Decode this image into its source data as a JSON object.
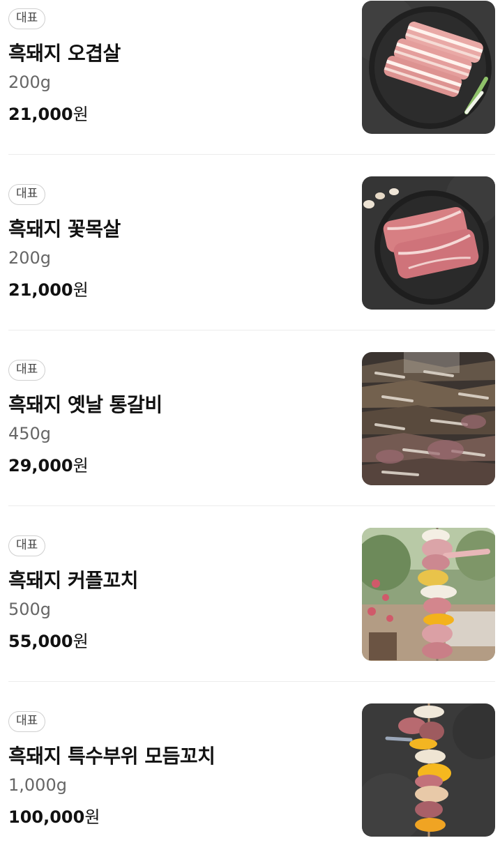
{
  "menu": {
    "items": [
      {
        "badge": "대표",
        "name": "흑돼지 오겹살",
        "weight": "200g",
        "price": "21,000",
        "currency": "원",
        "image_icon": "pork-belly-plate-image"
      },
      {
        "badge": "대표",
        "name": "흑돼지 꽃목살",
        "weight": "200g",
        "price": "21,000",
        "currency": "원",
        "image_icon": "pork-neck-plate-image"
      },
      {
        "badge": "대표",
        "name": "흑돼지 옛날 통갈비",
        "weight": "450g",
        "price": "29,000",
        "currency": "원",
        "image_icon": "grilled-ribs-image"
      },
      {
        "badge": "대표",
        "name": "흑돼지 커플꼬치",
        "weight": "500g",
        "price": "55,000",
        "currency": "원",
        "image_icon": "couple-skewer-image"
      },
      {
        "badge": "대표",
        "name": "흑돼지 특수부위 모듬꼬치",
        "weight": "1,000g",
        "price": "100,000",
        "currency": "원",
        "image_icon": "assorted-skewer-image"
      }
    ]
  },
  "colors": {
    "text": "#111111",
    "muted": "#666666",
    "badge_border": "#cfcfcf",
    "divider": "#ececec"
  }
}
